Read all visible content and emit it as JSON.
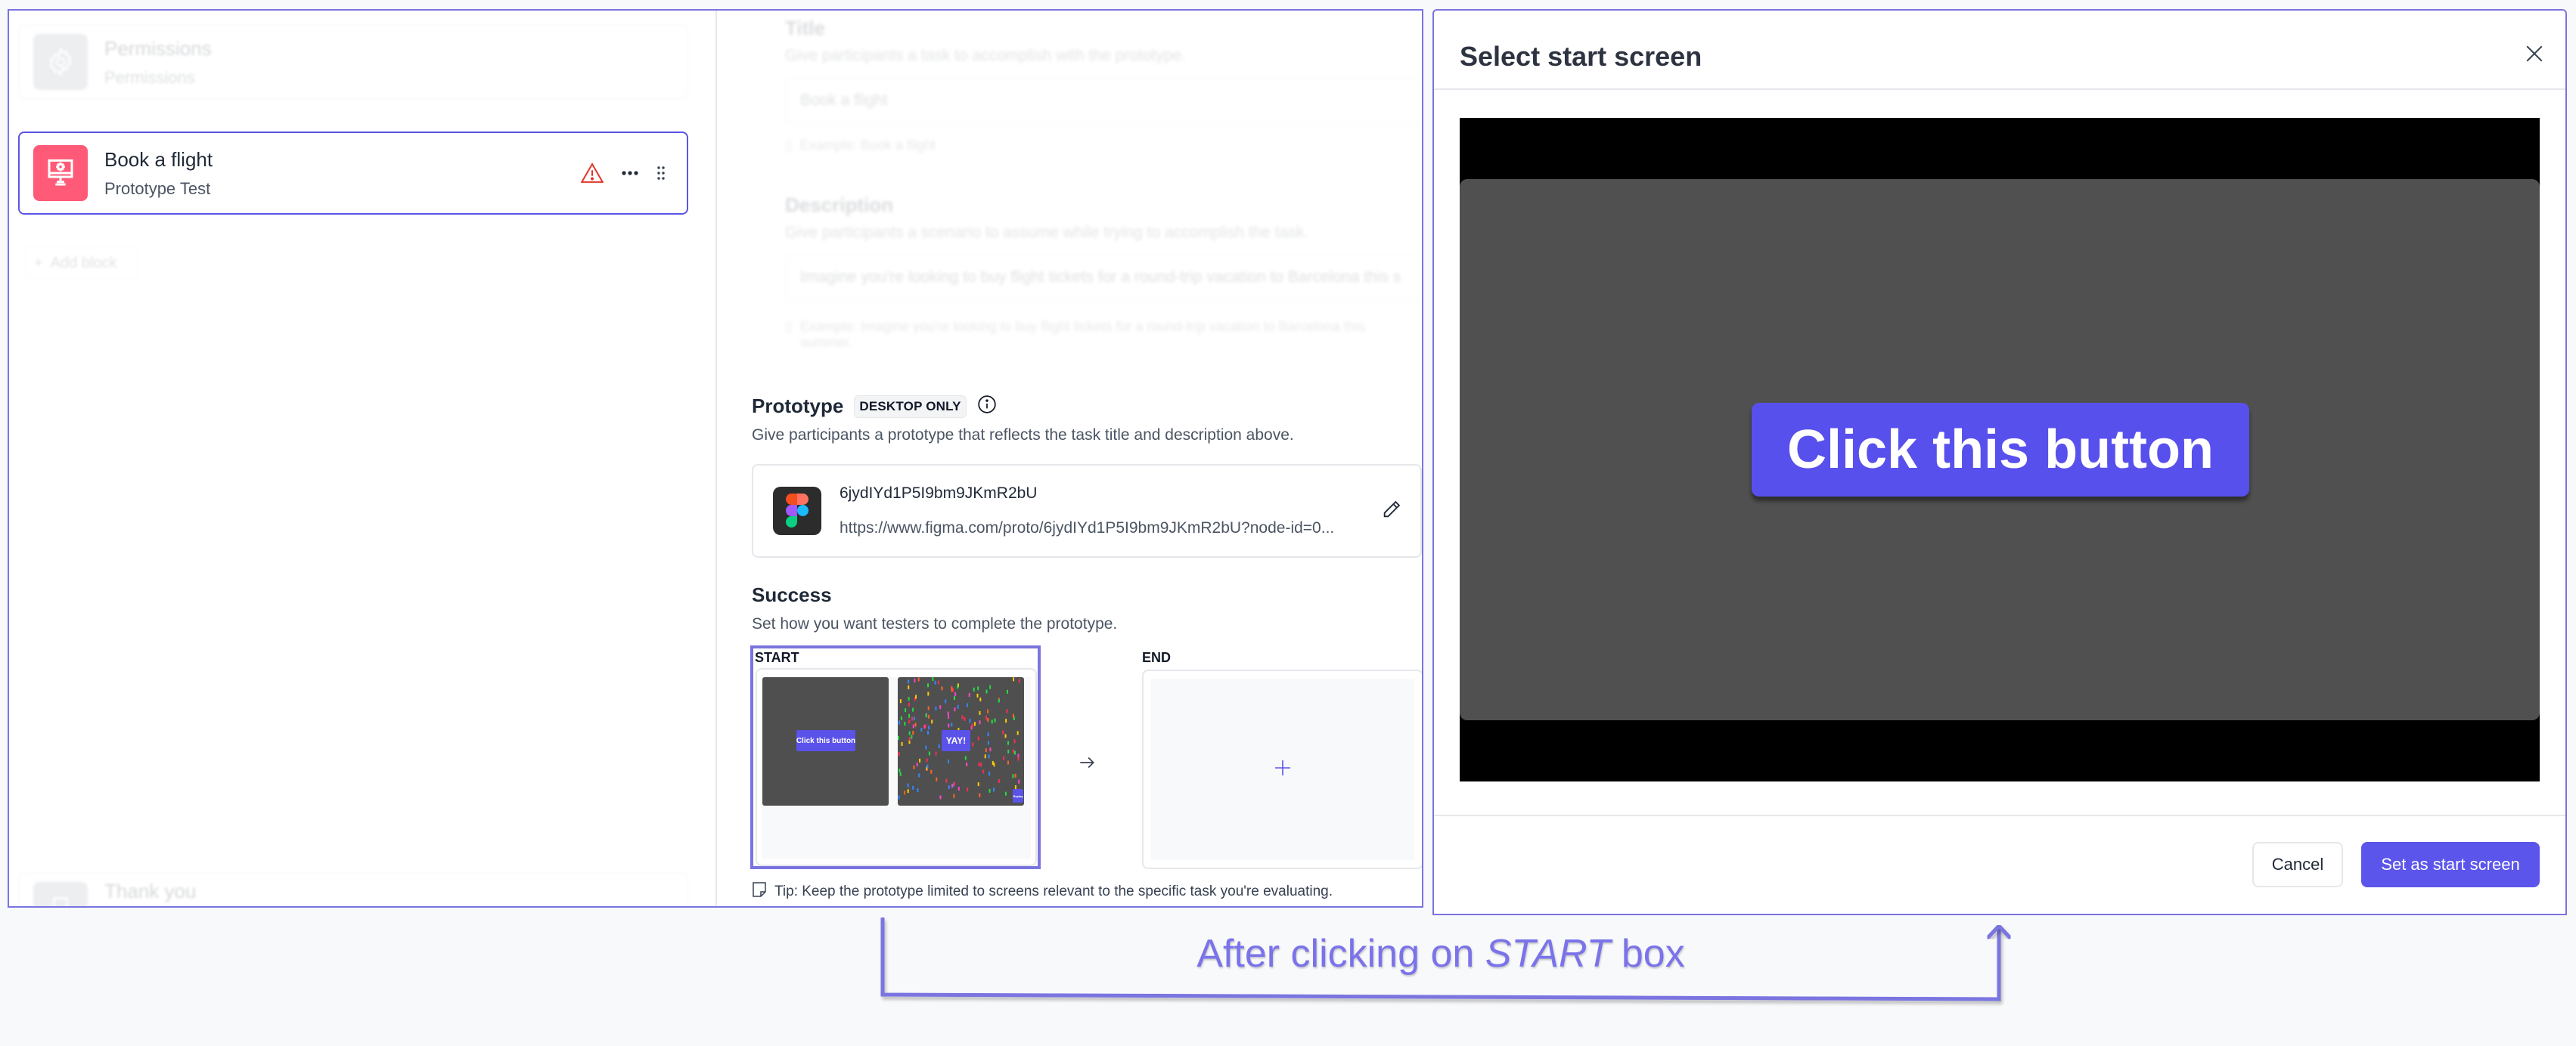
{
  "sidebar": {
    "blocks": [
      {
        "title": "Permissions",
        "subtitle": "Permissions",
        "icon": "gear-icon",
        "state": "faded"
      },
      {
        "title": "Book a flight",
        "subtitle": "Prototype Test",
        "icon": "monitor-gear-icon",
        "state": "selected",
        "icon_color": "#ff5a78",
        "warning": true
      },
      {
        "title": "Thank you",
        "subtitle": "",
        "icon": "trophy-icon",
        "state": "faded"
      }
    ],
    "add_block_label": "Add block"
  },
  "form": {
    "title": {
      "label": "Title",
      "help": "Give participants a task to accomplish with the prototype.",
      "value": "Book a flight",
      "example": "Example: Book a flight"
    },
    "description": {
      "label": "Description",
      "help": "Give participants a scenario to assume while trying to accomplish the task.",
      "value": "Imagine you're looking to buy flight tickets for a round-trip vacation to Barcelona this s",
      "example": "Example: Imagine you're looking to buy flight tickets for a round-trip vacation to Barcelona this summer."
    },
    "prototype": {
      "label": "Prototype",
      "badge": "DESKTOP ONLY",
      "help": "Give participants a prototype that reflects the task title and description above.",
      "name": "6jydIYd1P5I9bm9JKmR2bU",
      "url": "https://www.figma.com/proto/6jydIYd1P5I9bm9JKmR2bU?node-id=0..."
    },
    "success": {
      "label": "Success",
      "help": "Set how you want testers to complete the prototype.",
      "start_label": "START",
      "end_label": "END",
      "thumbnails": [
        {
          "button_text": "Click this button"
        },
        {
          "button_text": "YAY!",
          "corner_text": "Replay"
        }
      ],
      "tip": "Tip: Keep the prototype limited to screens relevant to the specific task you're evaluating."
    }
  },
  "modal": {
    "title": "Select start screen",
    "preview_button_text": "Click this button",
    "cancel_label": "Cancel",
    "primary_label": "Set as start screen"
  },
  "annotation": {
    "caption_before": "After clicking on ",
    "caption_emphasis": "START",
    "caption_after": " box"
  },
  "colors": {
    "accent": "#5b55eb",
    "annotation": "#7a74e0",
    "warning": "#e0352b",
    "block_icon": "#ff5a78"
  }
}
